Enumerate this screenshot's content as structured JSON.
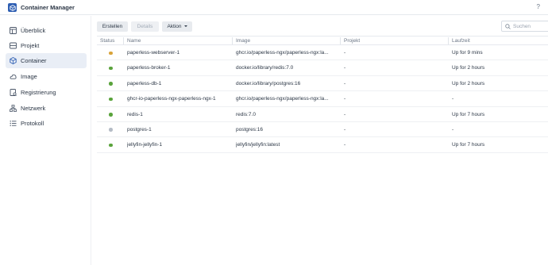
{
  "app": {
    "title": "Container Manager",
    "help_label": "?"
  },
  "sidebar": {
    "items": [
      {
        "label": "Überblick",
        "icon": "overview-icon",
        "active": false
      },
      {
        "label": "Projekt",
        "icon": "project-icon",
        "active": false
      },
      {
        "label": "Container",
        "icon": "container-icon",
        "active": true
      },
      {
        "label": "Image",
        "icon": "image-icon",
        "active": false
      },
      {
        "label": "Registrierung",
        "icon": "registry-icon",
        "active": false
      },
      {
        "label": "Netzwerk",
        "icon": "network-icon",
        "active": false
      },
      {
        "label": "Protokoll",
        "icon": "log-icon",
        "active": false
      }
    ]
  },
  "toolbar": {
    "create_label": "Erstellen",
    "details_label": "Details",
    "action_label": "Aktion"
  },
  "search": {
    "placeholder": "Suchen",
    "value": ""
  },
  "table": {
    "headers": [
      "Status",
      "Name",
      "Image",
      "Projekt",
      "Laufzeit"
    ],
    "rows": [
      {
        "status": "starting",
        "name": "paperless-webserver-1",
        "image": "ghcr.io/paperless-ngx/paperless-ngx:la...",
        "project": "-",
        "uptime": "Up for 9 mins"
      },
      {
        "status": "running",
        "name": "paperless-broker-1",
        "image": "docker.io/library/redis:7.0",
        "project": "-",
        "uptime": "Up for 2 hours"
      },
      {
        "status": "running",
        "name": "paperless-db-1",
        "image": "docker.io/library/postgres:16",
        "project": "-",
        "uptime": "Up for 2 hours"
      },
      {
        "status": "running",
        "name": "ghcr-io-paperless-ngx-paperless-ngx-1",
        "image": "ghcr.io/paperless-ngx/paperless-ngx:la...",
        "project": "-",
        "uptime": "-"
      },
      {
        "status": "running",
        "name": "redis-1",
        "image": "redis:7.0",
        "project": "-",
        "uptime": "Up for 7 hours"
      },
      {
        "status": "stopped",
        "name": "postgres-1",
        "image": "postgres:16",
        "project": "-",
        "uptime": "-"
      },
      {
        "status": "running",
        "name": "jellyfin-jellyfin-1",
        "image": "jellyfin/jellyfin:latest",
        "project": "-",
        "uptime": "Up for 7 hours"
      }
    ]
  },
  "colors": {
    "accent": "#2f5fb3",
    "status_running": "#5aa33c",
    "status_starting": "#d9a43a",
    "status_stopped": "#b5bcc6",
    "active_nav_bg": "#e9eef6"
  }
}
